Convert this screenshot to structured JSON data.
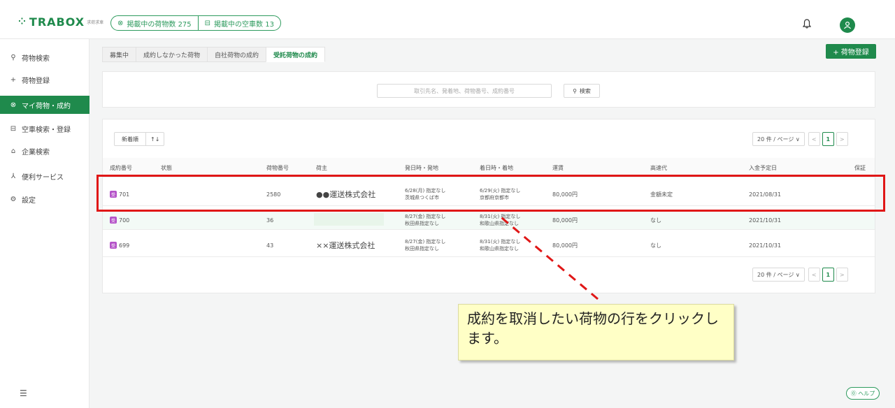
{
  "header": {
    "logo_mark": "⁘",
    "logo_text": "TRABOX",
    "logo_sub": "求荷求車",
    "stats": [
      {
        "icon": "box-icon",
        "label": "掲載中の荷物数 275"
      },
      {
        "icon": "truck-icon",
        "label": "掲載中の空車数 13"
      }
    ]
  },
  "sidebar": {
    "items": [
      {
        "icon": "search-icon",
        "label": "荷物検索"
      },
      {
        "icon": "plus-icon",
        "label": "荷物登録"
      },
      {
        "icon": "box-icon",
        "label": "マイ荷物・成約"
      },
      {
        "icon": "truck-icon",
        "label": "空車検索・登録"
      },
      {
        "icon": "building-icon",
        "label": "企業検索"
      },
      {
        "icon": "people-icon",
        "label": "便利サービス"
      },
      {
        "icon": "gear-icon",
        "label": "設定"
      }
    ],
    "active_index": 2
  },
  "tabs": [
    "募集中",
    "成約しなかった荷物",
    "自社荷物の成約",
    "受託荷物の成約"
  ],
  "active_tab": 3,
  "register_button": "+ 荷物登録",
  "search": {
    "placeholder": "取引先名、発着地、荷物番号、成約番号",
    "button": "検索"
  },
  "sort": {
    "label": "新着順",
    "arrow": "↑↓"
  },
  "pager": {
    "size": "20 件 / ページ",
    "current": "1",
    "prev": "<",
    "next": ">"
  },
  "table": {
    "headers": [
      "成約番号",
      "状態",
      "荷物番号",
      "荷主",
      "発日時・発地",
      "着日時・着地",
      "運賃",
      "高速代",
      "入金予定日",
      "保証"
    ],
    "rows": [
      {
        "id": "701",
        "status": "",
        "cargo_no": "2580",
        "shipper": "●●運送株式会社",
        "dep1": "6/28(月) 指定なし",
        "dep2": "茨城県つくば市",
        "arr1": "6/29(火) 指定なし",
        "arr2": "京都府京都市",
        "fare": "80,000円",
        "toll": "金額未定",
        "pay_date": "2021/08/31",
        "guarantee": ""
      },
      {
        "id": "700",
        "status": "",
        "cargo_no": "36",
        "shipper": "",
        "dep1": "8/27(金) 指定なし",
        "dep2": "秋田県指定なし",
        "arr1": "8/31(火) 指定なし",
        "arr2": "和歌山県指定なし",
        "fare": "80,000円",
        "toll": "なし",
        "pay_date": "2021/10/31",
        "guarantee": ""
      },
      {
        "id": "699",
        "status": "",
        "cargo_no": "43",
        "shipper": "××運送株式会社",
        "dep1": "8/27(金) 指定なし",
        "dep2": "秋田県指定なし",
        "arr1": "8/31(火) 指定なし",
        "arr2": "和歌山県指定なし",
        "fare": "80,000円",
        "toll": "なし",
        "pay_date": "2021/10/31",
        "guarantee": ""
      }
    ]
  },
  "annotation": "成約を取消したい荷物の行をクリックします。",
  "help_button": "ヘルプ",
  "colors": {
    "brand": "#1f8a4c",
    "highlight": "#e01717",
    "badge": "#b452c8",
    "note_bg": "#ffffc6"
  }
}
